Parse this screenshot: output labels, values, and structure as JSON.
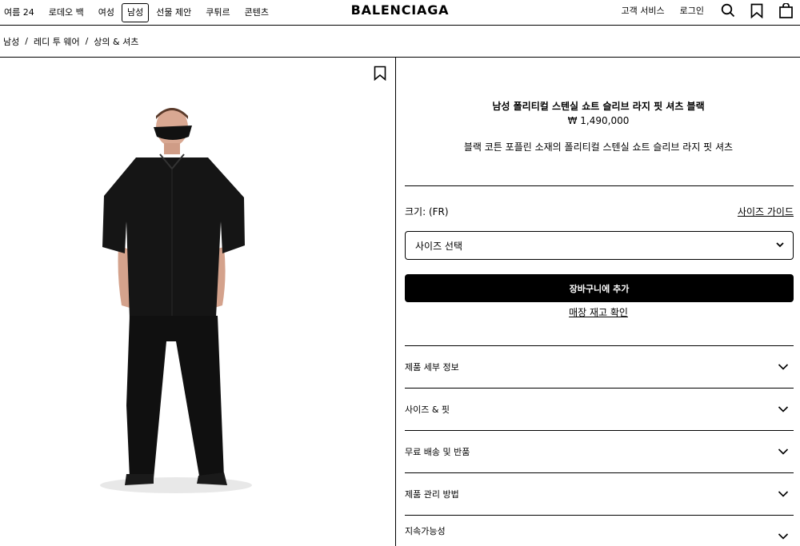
{
  "nav": {
    "items": [
      {
        "label": "여름 24",
        "active": false
      },
      {
        "label": "로데오 백",
        "active": false
      },
      {
        "label": "여성",
        "active": false
      },
      {
        "label": "남성",
        "active": true
      },
      {
        "label": "선물 제안",
        "active": false
      },
      {
        "label": "쿠튀르",
        "active": false
      },
      {
        "label": "콘텐츠",
        "active": false
      }
    ],
    "logo": "BALENCIAGA",
    "customer_service": "고객 서비스",
    "login": "로그인",
    "icons": [
      "search-icon",
      "bookmark-icon",
      "shopping-bag-icon"
    ]
  },
  "breadcrumb": [
    "남성",
    "레디 투 웨어",
    "상의 & 셔츠"
  ],
  "breadcrumb_separator": "/",
  "product": {
    "title": "남성 폴리티컬 스텐실 쇼트 슬리브 라지 핏 셔츠 블랙",
    "price": "₩ 1,490,000",
    "description": "블랙 코튼 포플린 소재의 폴리티컬 스텐실 쇼트 슬리브 라지 핏 셔츠",
    "size_label": "크기: (FR)",
    "size_guide": "사이즈 가이드",
    "size_select": "사이즈 선택",
    "add_to_cart": "장바구니에 추가",
    "check_stock": "매장 재고 확인"
  },
  "accordion": [
    "제품 세부 정보",
    "사이즈 & 핏",
    "무료 배송 및 반품",
    "제품 관리 방법",
    "지속가능성"
  ],
  "colors": {
    "accent": "#000000",
    "background": "#ffffff",
    "button_text": "#ffffff"
  }
}
